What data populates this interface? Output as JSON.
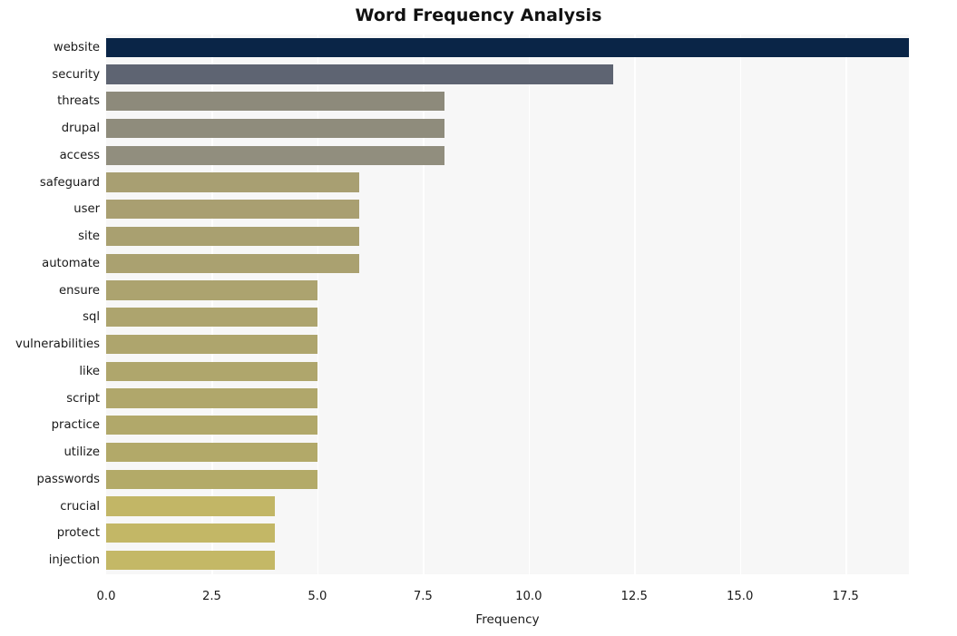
{
  "chart_data": {
    "type": "bar",
    "orientation": "horizontal",
    "title": "Word Frequency Analysis",
    "xlabel": "Frequency",
    "ylabel": "",
    "categories": [
      "website",
      "security",
      "threats",
      "drupal",
      "access",
      "safeguard",
      "user",
      "site",
      "automate",
      "ensure",
      "sql",
      "vulnerabilities",
      "like",
      "script",
      "practice",
      "utilize",
      "passwords",
      "crucial",
      "protect",
      "injection"
    ],
    "values": [
      19,
      12,
      8,
      8,
      8,
      6,
      6,
      6,
      6,
      5,
      5,
      5,
      5,
      5,
      5,
      5,
      5,
      4,
      4,
      4
    ],
    "bar_colors": [
      "#0a2547",
      "#5e6472",
      "#8d8a7b",
      "#8f8c7c",
      "#918e7e",
      "#a89f72",
      "#a99f71",
      "#a9a070",
      "#aaa170",
      "#aca36f",
      "#ada46e",
      "#aea56d",
      "#afa66c",
      "#b0a76b",
      "#b1a86a",
      "#b2a969",
      "#b3aa68",
      "#c2b666",
      "#c3b766",
      "#c4b866"
    ],
    "xticks": [
      "0.0",
      "2.5",
      "5.0",
      "7.5",
      "10.0",
      "12.5",
      "15.0",
      "17.5"
    ],
    "xtick_values": [
      0,
      2.5,
      5,
      7.5,
      10,
      12.5,
      15,
      17.5
    ],
    "xlim": [
      0,
      19.0
    ],
    "grid": true,
    "grid_axis": "x",
    "legend": "none",
    "plot_background": "#f7f7f7",
    "gridline_color": "#ffffff",
    "figure_background": "#ffffff"
  }
}
